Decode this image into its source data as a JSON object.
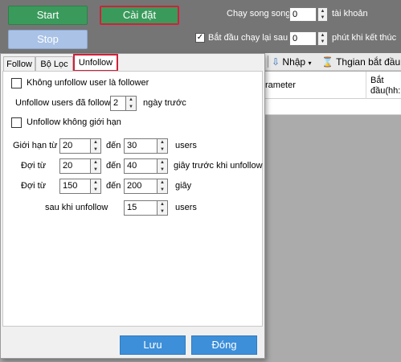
{
  "main": {
    "start_label": "Start",
    "settings_label": "Cài đặt",
    "stop_label": "Stop",
    "parallel_label": "Chạy song song",
    "parallel_value": "0",
    "accounts_label": "tài khoản",
    "restart_checked": true,
    "restart_label": "Bắt đầu chạy lại sau",
    "restart_value": "0",
    "restart_suffix": "phút khi kết thúc"
  },
  "toolbar": {
    "import_label": "Nhập",
    "start_time_label": "Thgian bắt đầu"
  },
  "grid": {
    "col_parameter": "rameter",
    "col_start_line1": "Bắt",
    "col_start_line2": "đầu(hh:"
  },
  "dialog": {
    "tabs": [
      "Follow",
      "Bộ Lọc",
      "Unfollow"
    ],
    "active_tab": "Unfollow",
    "unfollow_non_follower": {
      "label": "Không unfollow user là follower",
      "checked": false
    },
    "followed_days": {
      "prefix": "Unfollow users đã follow",
      "value": "2",
      "suffix": "ngày trước"
    },
    "unlimited": {
      "label": "Unfollow không giới hạn",
      "checked": false
    },
    "limit": {
      "label": "Giới hạn từ",
      "from": "20",
      "to_label": "đến",
      "to": "30",
      "unit": "users"
    },
    "wait_before": {
      "label": "Đợi từ",
      "from": "20",
      "to_label": "đến",
      "to": "40",
      "unit": "giây trước khi unfollow"
    },
    "wait_between": {
      "label": "Đợi từ",
      "from": "150",
      "to_label": "đến",
      "to": "200",
      "unit": "giây"
    },
    "after_unfollow": {
      "label": "sau khi unfollow",
      "value": "15",
      "unit": "users"
    },
    "save_label": "Lưu",
    "close_label": "Đóng"
  }
}
